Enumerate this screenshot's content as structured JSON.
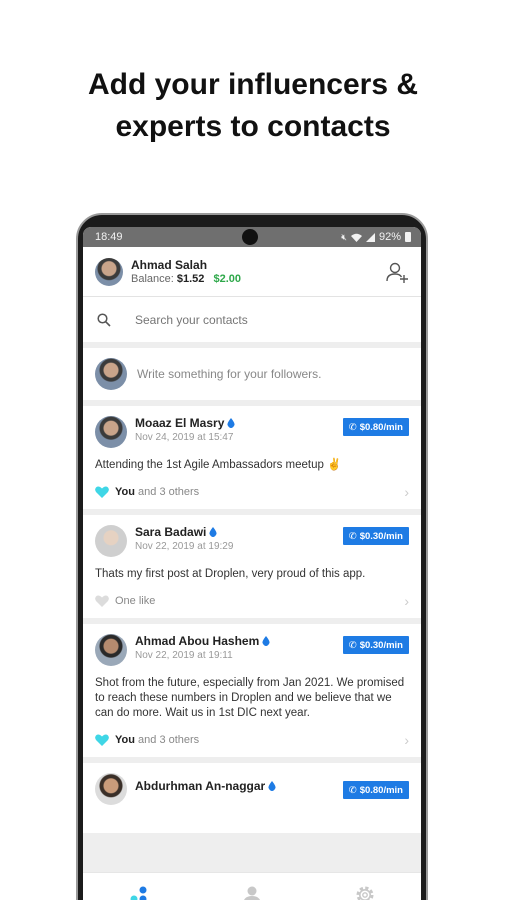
{
  "headline": {
    "line1": "Add your influencers &",
    "line2": "experts to contacts"
  },
  "status_bar": {
    "time": "18:49",
    "battery": "92%",
    "icons": [
      "mute-icon",
      "wifi-icon",
      "signal-icon",
      "battery-icon"
    ]
  },
  "header": {
    "user_name": "Ahmad Salah",
    "balance_label": "Balance:",
    "balance_value": "$1.52",
    "credit_value": "$2.00",
    "add_contact_icon": "add-contact-icon"
  },
  "search": {
    "placeholder": "Search your contacts"
  },
  "compose": {
    "placeholder": "Write something for your followers."
  },
  "posts": [
    {
      "author": "Moaaz El Masry",
      "date": "Nov 24, 2019 at 15:47",
      "rate": "$0.80/min",
      "text": "Attending the 1st Agile Ambassadors meetup ✌️",
      "like_you": "You",
      "like_rest": "and 3 others",
      "liked": true
    },
    {
      "author": "Sara Badawi",
      "date": "Nov 22, 2019 at 19:29",
      "rate": "$0.30/min",
      "text": "Thats my first post at Droplen, very proud of this app.",
      "like_you": "",
      "like_rest": "One like",
      "liked": false
    },
    {
      "author": "Ahmad Abou Hashem",
      "date": "Nov 22, 2019 at 19:11",
      "rate": "$0.30/min",
      "text": "Shot from the future, especially from Jan 2021. We promised to reach these numbers in Droplen and we believe that we can do more. Wait us in 1st DIC next year.",
      "like_you": "You",
      "like_rest": "and 3 others",
      "liked": true
    },
    {
      "author": "Abdurhman An-naggar",
      "date": "",
      "rate": "$0.80/min",
      "text": "",
      "like_you": "",
      "like_rest": "",
      "liked": false
    }
  ],
  "bottom_nav": [
    "feed-icon",
    "profile-icon",
    "settings-icon"
  ],
  "colors": {
    "accent": "#1e7be4",
    "credit": "#2ea84a",
    "like": "#3fd6e6",
    "nav_active": "#1e7be4"
  }
}
